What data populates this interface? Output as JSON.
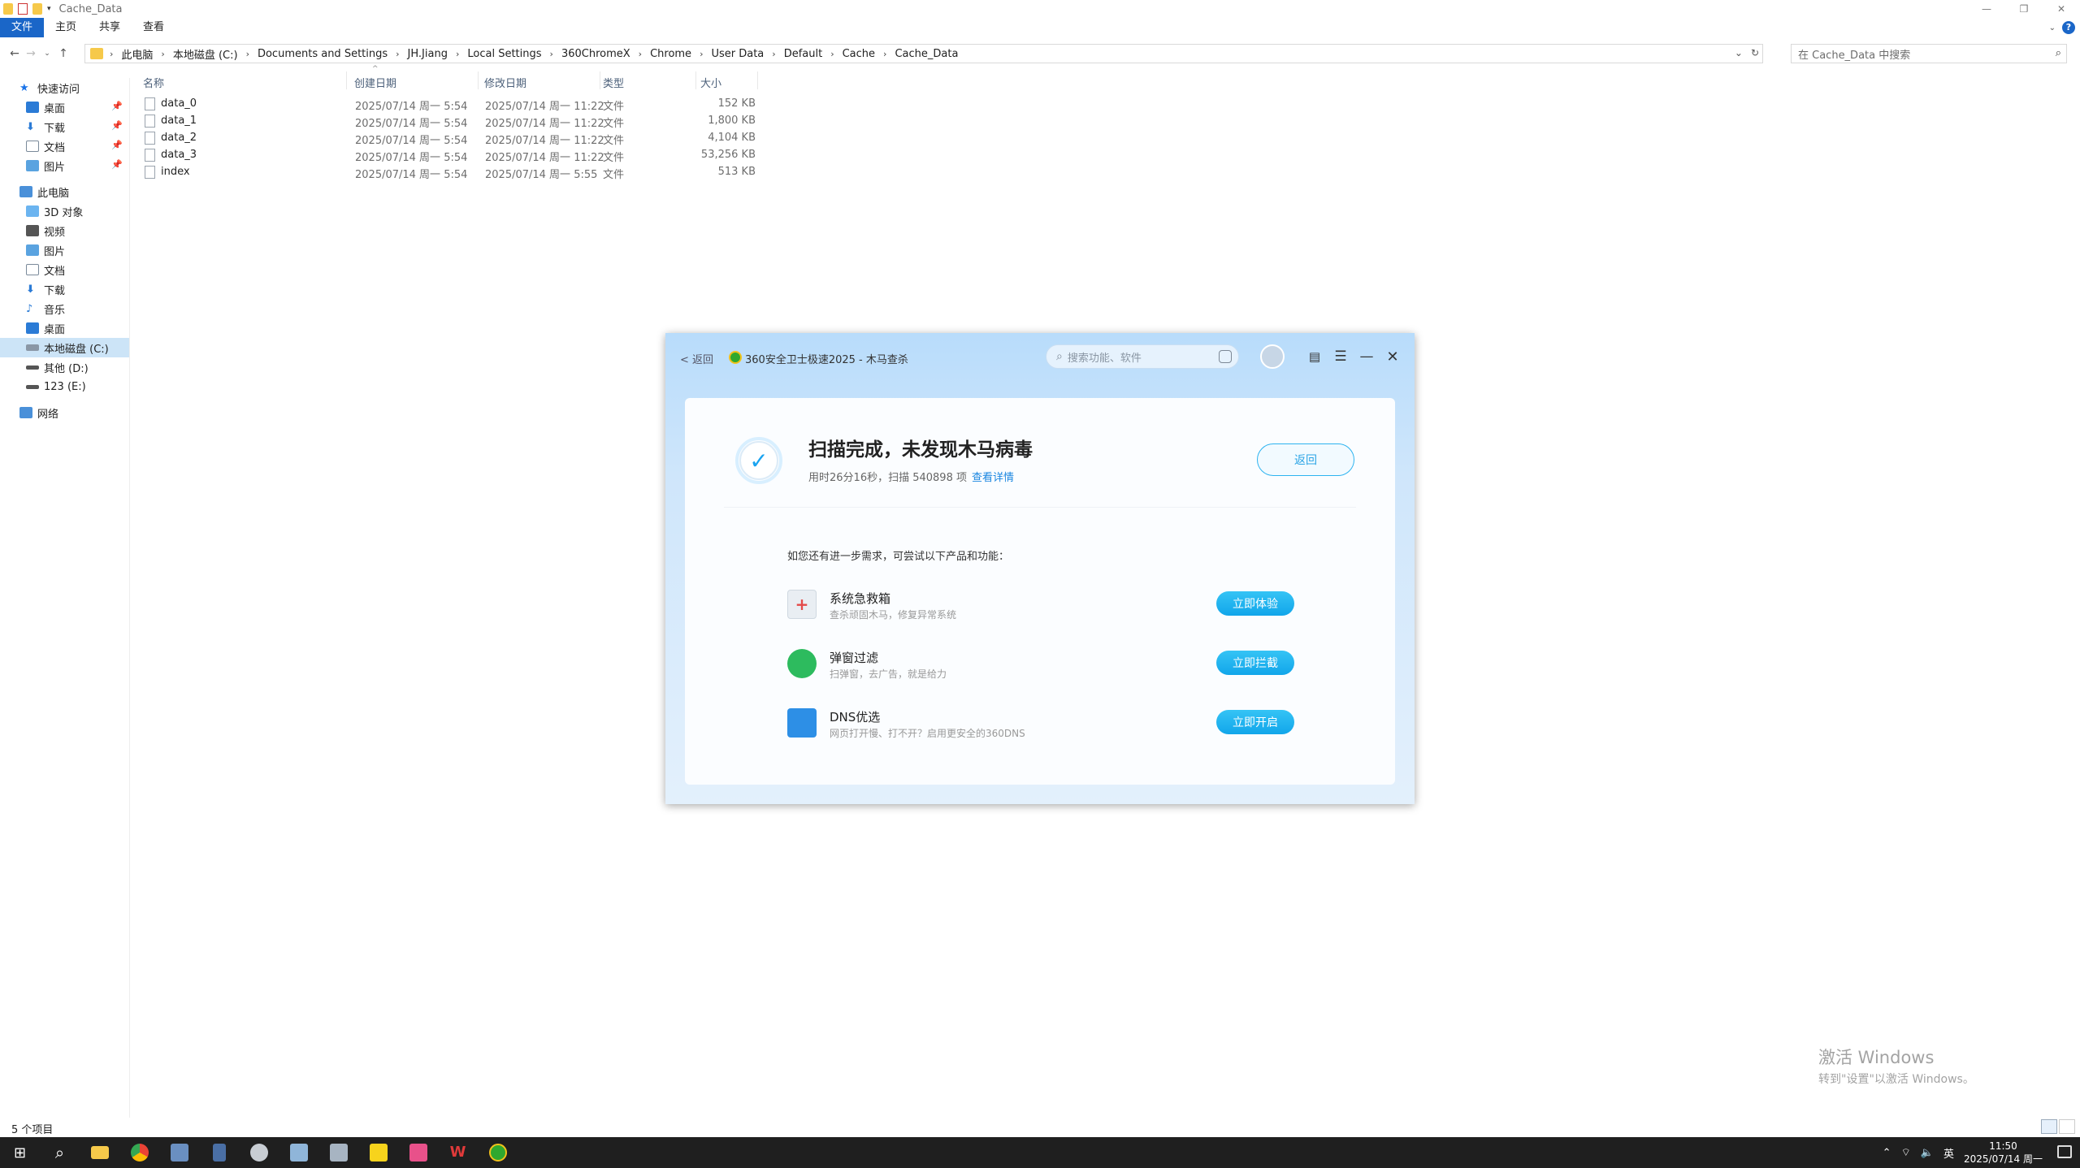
{
  "window": {
    "title": "Cache_Data",
    "ribbon_tabs": [
      "文件",
      "主页",
      "共享",
      "查看"
    ]
  },
  "address": {
    "crumbs": [
      "此电脑",
      "本地磁盘 (C:)",
      "Documents and Settings",
      "JH.Jiang",
      "Local Settings",
      "360ChromeX",
      "Chrome",
      "User Data",
      "Default",
      "Cache",
      "Cache_Data"
    ],
    "search_placeholder": "在 Cache_Data 中搜索"
  },
  "sidebar": {
    "quick_access": "快速访问",
    "quick_items": [
      "桌面",
      "下载",
      "文档",
      "图片"
    ],
    "this_pc": "此电脑",
    "pc_items": [
      "3D 对象",
      "视频",
      "图片",
      "文档",
      "下载",
      "音乐",
      "桌面",
      "本地磁盘 (C:)",
      "其他 (D:)",
      "123 (E:)"
    ],
    "network": "网络"
  },
  "columns": {
    "name": "名称",
    "created": "创建日期",
    "modified": "修改日期",
    "type": "类型",
    "size": "大小"
  },
  "files": [
    {
      "name": "data_0",
      "created": "2025/07/14 周一 5:54",
      "modified": "2025/07/14 周一 11:22",
      "type": "文件",
      "size": "152 KB"
    },
    {
      "name": "data_1",
      "created": "2025/07/14 周一 5:54",
      "modified": "2025/07/14 周一 11:22",
      "type": "文件",
      "size": "1,800 KB"
    },
    {
      "name": "data_2",
      "created": "2025/07/14 周一 5:54",
      "modified": "2025/07/14 周一 11:22",
      "type": "文件",
      "size": "4,104 KB"
    },
    {
      "name": "data_3",
      "created": "2025/07/14 周一 5:54",
      "modified": "2025/07/14 周一 11:22",
      "type": "文件",
      "size": "53,256 KB"
    },
    {
      "name": "index",
      "created": "2025/07/14 周一 5:54",
      "modified": "2025/07/14 周一 5:55",
      "type": "文件",
      "size": "513 KB"
    }
  ],
  "status": {
    "count": "5 个项目"
  },
  "watermark": {
    "line1": "激活 Windows",
    "line2": "转到\"设置\"以激活 Windows。"
  },
  "dialog": {
    "back_link": "< 返回",
    "title": "360安全卫士极速2025 - 木马查杀",
    "search_placeholder": "搜索功能、软件",
    "result_title": "扫描完成，未发现木马病毒",
    "result_sub": "用时26分16秒，扫描 540898 项",
    "detail_link": "查看详情",
    "back_button": "返回",
    "suggest": "如您还有进一步需求，可尝试以下产品和功能：",
    "products": [
      {
        "name": "系统急救箱",
        "desc": "查杀顽固木马，修复异常系统",
        "button": "立即体验",
        "color": "#e9eef3"
      },
      {
        "name": "弹窗过滤",
        "desc": "扫弹窗，去广告，就是给力",
        "button": "立即拦截",
        "color": "#2dbb5e"
      },
      {
        "name": "DNS优选",
        "desc": "网页打开慢、打不开？启用更安全的360DNS",
        "button": "立即开启",
        "color": "#2d8fe6"
      }
    ]
  },
  "taskbar": {
    "clock_time": "11:50",
    "clock_date": "2025/07/14 周一",
    "ime": "英"
  }
}
